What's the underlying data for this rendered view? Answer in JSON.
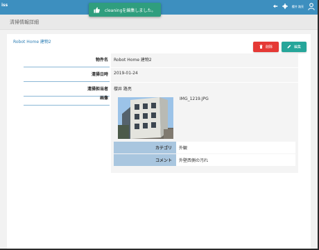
{
  "app": {
    "brand": "iss"
  },
  "toast": {
    "message": "cleaningを編集しました。",
    "icon": "thumbs-up-icon"
  },
  "header": {
    "user_name": "櫻井 路亮",
    "icons": [
      "logout-icon",
      "gear-icon",
      "account-icon"
    ]
  },
  "page": {
    "title": "清掃情報詳細"
  },
  "record": {
    "title": "Robot Home 建物2",
    "delete_label": "削除",
    "edit_label": "編集",
    "fields": [
      {
        "label": "物件名",
        "value": "Robot Home 建物2"
      },
      {
        "label": "清掃日時",
        "value": "2019-01-24"
      },
      {
        "label": "清掃担当者",
        "value": "櫻井 路亮"
      }
    ],
    "image": {
      "label": "画像",
      "file_name": "IMG_1219.JPG",
      "category_label": "カテゴリ",
      "category_value": "外観",
      "comment_label": "コメント",
      "comment_value": "外壁西側の汚れ"
    }
  },
  "colors": {
    "topbar": "#3d8fbf",
    "toast": "#2f9e7e",
    "delete": "#e53935",
    "edit": "#26a69a",
    "link": "#2f7fb5"
  }
}
